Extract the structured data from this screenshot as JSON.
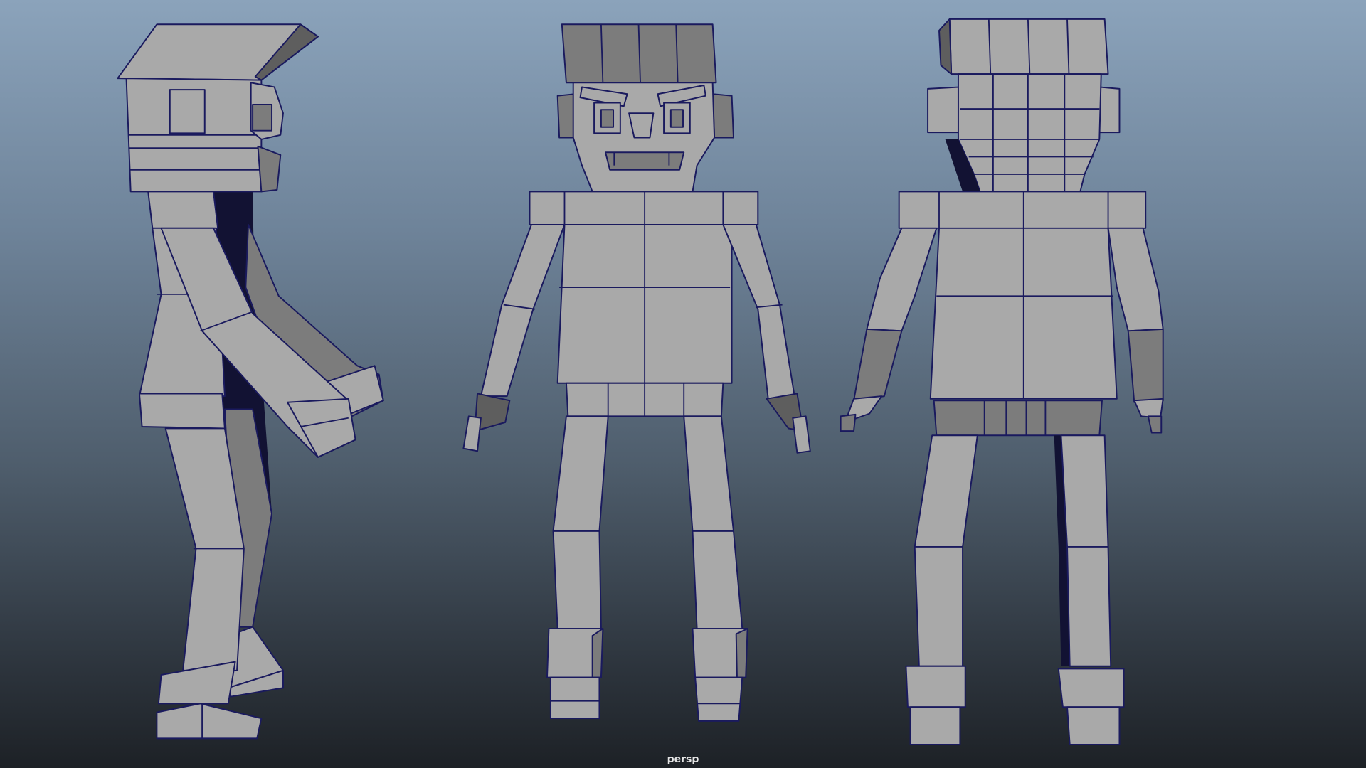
{
  "viewport": {
    "camera_label": "persp"
  },
  "scene": {
    "views": [
      "side-view",
      "front-view",
      "back-view"
    ]
  }
}
